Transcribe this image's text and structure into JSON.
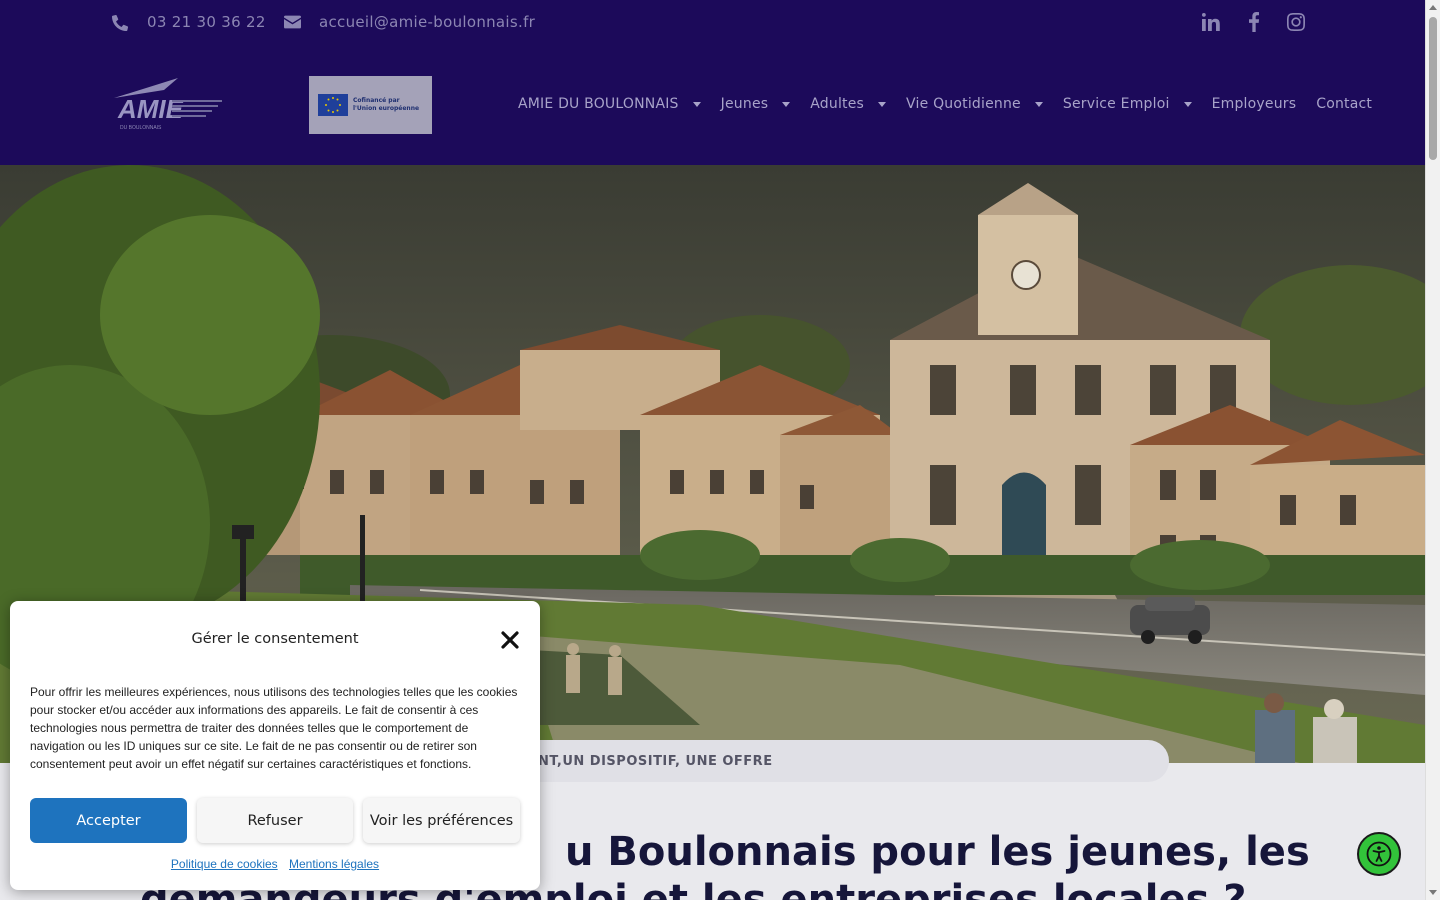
{
  "topbar": {
    "phone": "03 21 30 36 22",
    "email": "accueil@amie-boulonnais.fr",
    "social": [
      "linkedin-icon",
      "facebook-icon",
      "instagram-icon"
    ]
  },
  "logo": {
    "text": "AMIE",
    "sub": "DU BOULONNAIS"
  },
  "eu_badge": {
    "line1": "Cofinancé par",
    "line2": "l'Union européenne"
  },
  "nav": {
    "items": [
      {
        "label": "AMIE DU BOULONNAIS",
        "dropdown": true
      },
      {
        "label": "Jeunes",
        "dropdown": true
      },
      {
        "label": "Adultes",
        "dropdown": true
      },
      {
        "label": "Vie Quotidienne",
        "dropdown": true
      },
      {
        "label": "Service Emploi",
        "dropdown": true
      },
      {
        "label": "Employeurs",
        "dropdown": false
      },
      {
        "label": "Contact",
        "dropdown": false
      }
    ]
  },
  "hero": {
    "pill_text": "NT,UN DISPOSITIF, UNE OFFRE"
  },
  "headline": {
    "line1": "u Boulonnais pour les jeunes, les",
    "line2": "demandeurs d'emploi et les entreprises locales ?"
  },
  "consent": {
    "title": "Gérer le consentement",
    "body": "Pour offrir les meilleures expériences, nous utilisons des technologies telles que les cookies pour stocker et/ou accéder aux informations des appareils. Le fait de consentir à ces technologies nous permettra de traiter des données telles que le comportement de navigation ou les ID uniques sur ce site. Le fait de ne pas consentir ou de retirer son consentement peut avoir un effet négatif sur certaines caractéristiques et fonctions.",
    "accept": "Accepter",
    "refuse": "Refuser",
    "prefs": "Voir les préférences",
    "link_cookies": "Politique de cookies",
    "link_legal": "Mentions légales"
  },
  "colors": {
    "header_bg": "#1c0a5a",
    "accent_blue": "#1e73be",
    "a11y_green": "#32c33a"
  }
}
